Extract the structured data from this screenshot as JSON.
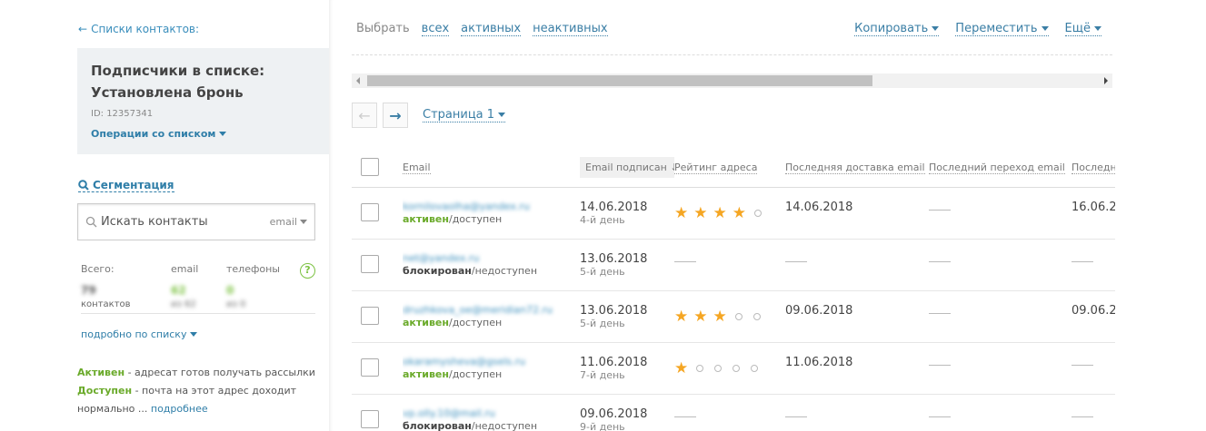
{
  "sidebar": {
    "back_label": "Списки контактов:",
    "list_title_line1": "Подписчики в списке:",
    "list_title_line2": "Установлена бронь",
    "list_id": "ID: 12357341",
    "list_ops": "Операции со списком",
    "segmentation": "Сегментация",
    "search_placeholder": "Искать контакты",
    "search_mode": "email",
    "stats": {
      "total_label": "Всего:",
      "email_label": "email",
      "phones_label": "телефоны",
      "help": "?",
      "total_value": "79",
      "total_sub": "контактов",
      "email_value": "62",
      "email_sub": "из 62",
      "phones_value": "0",
      "phones_sub": "из 0"
    },
    "more_list": "подробно по списку",
    "legend_active_label": "Активен",
    "legend_active_text": " - адресат готов получать рассылки",
    "legend_avail_label": "Доступен",
    "legend_avail_text": " - почта на этот адрес доходит",
    "legend_avail_text2": "нормально ...",
    "legend_more": "подробнее"
  },
  "toolbar": {
    "select_label": "Выбрать",
    "all": "всех",
    "active": "активных",
    "inactive": "неактивных",
    "copy": "Копировать",
    "move": "Переместить",
    "more": "Ещё"
  },
  "pager": {
    "prev": "←",
    "next": "→",
    "page_label": "Страница 1"
  },
  "table": {
    "headers": {
      "email": "Email",
      "subscribed": "Email подписан",
      "sort_icon": "↓",
      "rating": "Рейтинг адреса",
      "last_delivery": "Последняя доставка email",
      "last_click": "Последний переход email",
      "last_other": "Последн"
    },
    "rows": [
      {
        "email": "kornilovaolha@yandex.ru",
        "status_a": "активен",
        "status_b": "/доступен",
        "bad": false,
        "date": "14.06.2018",
        "day": "4-й день",
        "rating": 4,
        "delivery": "14.06.2018",
        "click": "",
        "other": "16.06.2"
      },
      {
        "email": "net@yandex.ru",
        "status_a": "блокирован",
        "status_b": "/недоступен",
        "bad": true,
        "date": "13.06.2018",
        "day": "5-й день",
        "rating": 0,
        "delivery": "",
        "click": "",
        "other": ""
      },
      {
        "email": "druzhkova_oe@meridian72.ru",
        "status_a": "активен",
        "status_b": "/доступен",
        "bad": false,
        "date": "13.06.2018",
        "day": "5-й день",
        "rating": 3,
        "delivery": "09.06.2018",
        "click": "",
        "other": "09.06.2"
      },
      {
        "email": "okaramysheva@gsels.ru",
        "status_a": "активен",
        "status_b": "/доступен",
        "bad": false,
        "date": "11.06.2018",
        "day": "7-й день",
        "rating": 1,
        "delivery": "11.06.2018",
        "click": "",
        "other": ""
      },
      {
        "email": "vp.olly.10@mail.ru",
        "status_a": "блокирован",
        "status_b": "/недоступен",
        "bad": true,
        "date": "09.06.2018",
        "day": "9-й день",
        "rating": 0,
        "delivery": "",
        "click": "",
        "other": ""
      }
    ]
  }
}
